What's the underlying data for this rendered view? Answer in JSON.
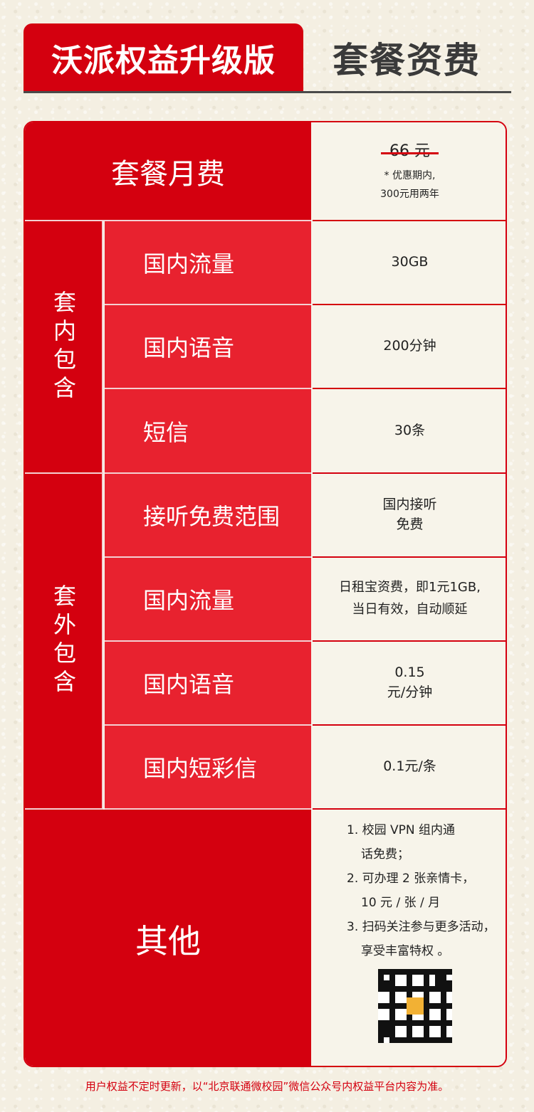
{
  "header": {
    "title": "沃派权益升级版",
    "subtitle": "套餐资费"
  },
  "monthly_fee": {
    "label": "套餐月费",
    "original_price": "66 元",
    "note_line1": "* 优惠期内,",
    "note_line2": "300元用两年"
  },
  "included": {
    "group_label": "套内包含",
    "rows": [
      {
        "label": "国内流量",
        "value": "30GB"
      },
      {
        "label": "国内语音",
        "value": "200分钟"
      },
      {
        "label": "短信",
        "value": "30条"
      }
    ]
  },
  "excluded": {
    "group_label": "套外包含",
    "rows": [
      {
        "label": "接听免费范围",
        "value_line1": "国内接听",
        "value_line2": "免费"
      },
      {
        "label": "国内流量",
        "value_line1": "日租宝资费，即1元1GB,",
        "value_line2": "当日有效，自动顺延"
      },
      {
        "label": "国内语音",
        "value_line1": "0.15",
        "value_line2": "元/分钟"
      },
      {
        "label": "国内短彩信",
        "value_line1": "0.1元/条",
        "value_line2": ""
      }
    ]
  },
  "others": {
    "label": "其他",
    "items": [
      "1. 校园 VPN 组内通",
      "话免费；",
      "2. 可办理 2 张亲情卡，",
      "10 元 / 张 / 月",
      "3. 扫码关注参与更多活动，",
      "享受丰富特权 。"
    ]
  },
  "footer": "用户权益不定时更新，以“北京联通微校园”微信公众号内权益平台内容为准。",
  "colors": {
    "brand_red": "#d4000f",
    "light_red": "#e8222f",
    "paper": "#f4efe2"
  }
}
